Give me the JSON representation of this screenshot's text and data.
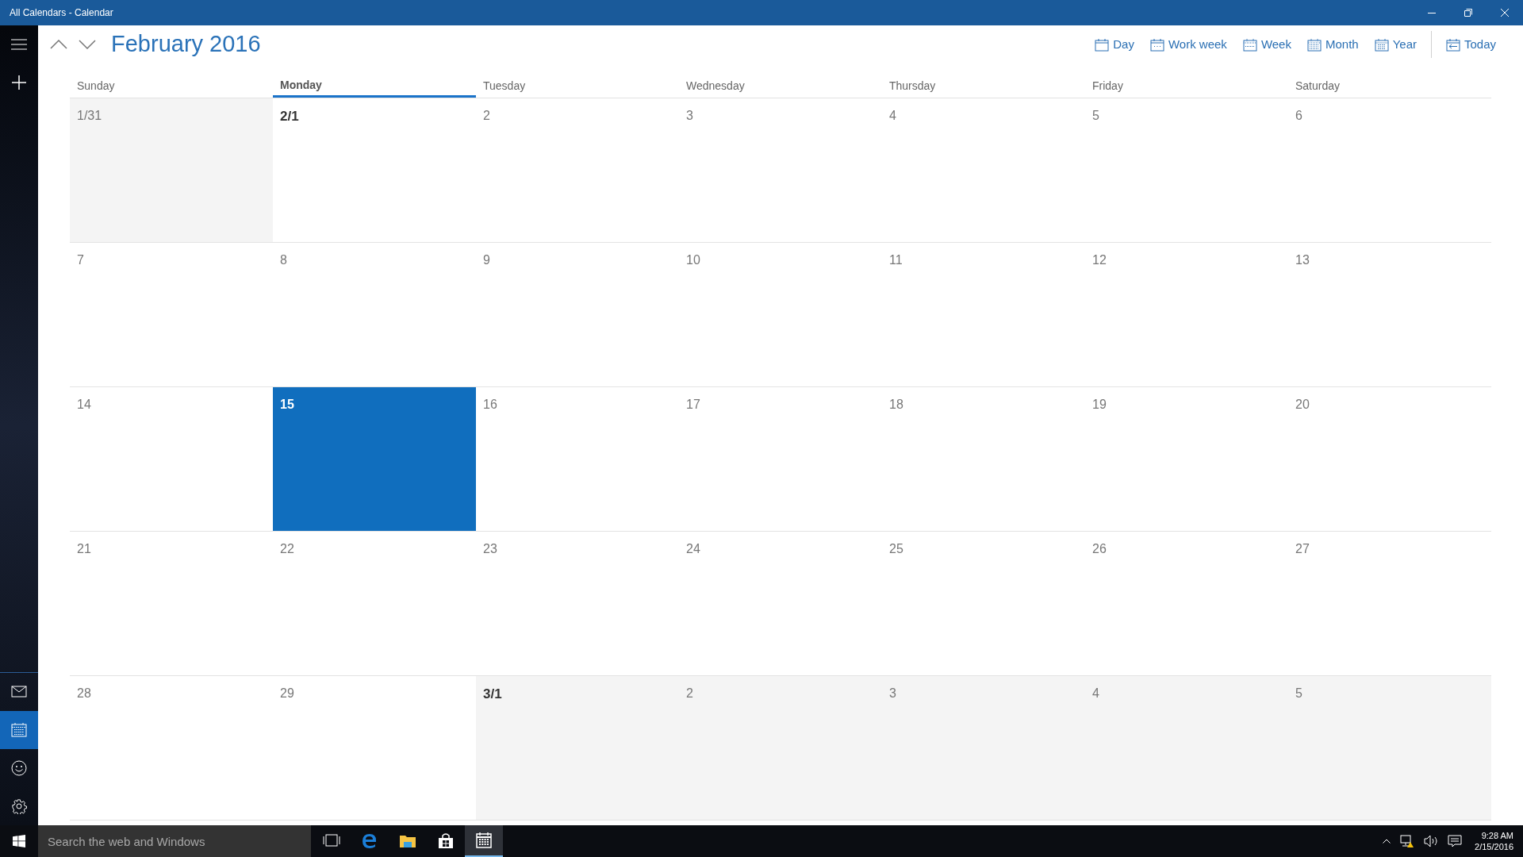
{
  "window": {
    "title": "All Calendars - Calendar"
  },
  "header": {
    "title": "February 2016"
  },
  "views": [
    {
      "label": "Day",
      "kind": "day"
    },
    {
      "label": "Work week",
      "kind": "workweek"
    },
    {
      "label": "Week",
      "kind": "week"
    },
    {
      "label": "Month",
      "kind": "month"
    },
    {
      "label": "Year",
      "kind": "year"
    },
    {
      "label": "Today",
      "kind": "today"
    }
  ],
  "nav": [
    {
      "kind": "mail",
      "selected": false
    },
    {
      "kind": "calendar",
      "selected": true
    },
    {
      "kind": "people",
      "selected": false
    },
    {
      "kind": "settings",
      "selected": false
    }
  ],
  "weekdays": [
    {
      "label": "Sunday",
      "selected": false
    },
    {
      "label": "Monday",
      "selected": true
    },
    {
      "label": "Tuesday",
      "selected": false
    },
    {
      "label": "Wednesday",
      "selected": false
    },
    {
      "label": "Thursday",
      "selected": false
    },
    {
      "label": "Friday",
      "selected": false
    },
    {
      "label": "Saturday",
      "selected": false
    }
  ],
  "weeks": [
    [
      {
        "label": "1/31",
        "kind": "adjacent",
        "month_start": false,
        "selected": false
      },
      {
        "label": "2/1",
        "kind": "current",
        "month_start": true,
        "selected": false
      },
      {
        "label": "2",
        "kind": "current",
        "month_start": false,
        "selected": false
      },
      {
        "label": "3",
        "kind": "current",
        "month_start": false,
        "selected": false
      },
      {
        "label": "4",
        "kind": "current",
        "month_start": false,
        "selected": false
      },
      {
        "label": "5",
        "kind": "current",
        "month_start": false,
        "selected": false
      },
      {
        "label": "6",
        "kind": "current",
        "month_start": false,
        "selected": false
      }
    ],
    [
      {
        "label": "7",
        "kind": "current",
        "month_start": false,
        "selected": false
      },
      {
        "label": "8",
        "kind": "current",
        "month_start": false,
        "selected": false
      },
      {
        "label": "9",
        "kind": "current",
        "month_start": false,
        "selected": false
      },
      {
        "label": "10",
        "kind": "current",
        "month_start": false,
        "selected": false
      },
      {
        "label": "11",
        "kind": "current",
        "month_start": false,
        "selected": false
      },
      {
        "label": "12",
        "kind": "current",
        "month_start": false,
        "selected": false
      },
      {
        "label": "13",
        "kind": "current",
        "month_start": false,
        "selected": false
      }
    ],
    [
      {
        "label": "14",
        "kind": "current",
        "month_start": false,
        "selected": false
      },
      {
        "label": "15",
        "kind": "current",
        "month_start": false,
        "selected": true
      },
      {
        "label": "16",
        "kind": "current",
        "month_start": false,
        "selected": false
      },
      {
        "label": "17",
        "kind": "current",
        "month_start": false,
        "selected": false
      },
      {
        "label": "18",
        "kind": "current",
        "month_start": false,
        "selected": false
      },
      {
        "label": "19",
        "kind": "current",
        "month_start": false,
        "selected": false
      },
      {
        "label": "20",
        "kind": "current",
        "month_start": false,
        "selected": false
      }
    ],
    [
      {
        "label": "21",
        "kind": "current",
        "month_start": false,
        "selected": false
      },
      {
        "label": "22",
        "kind": "current",
        "month_start": false,
        "selected": false
      },
      {
        "label": "23",
        "kind": "current",
        "month_start": false,
        "selected": false
      },
      {
        "label": "24",
        "kind": "current",
        "month_start": false,
        "selected": false
      },
      {
        "label": "25",
        "kind": "current",
        "month_start": false,
        "selected": false
      },
      {
        "label": "26",
        "kind": "current",
        "month_start": false,
        "selected": false
      },
      {
        "label": "27",
        "kind": "current",
        "month_start": false,
        "selected": false
      }
    ],
    [
      {
        "label": "28",
        "kind": "current",
        "month_start": false,
        "selected": false
      },
      {
        "label": "29",
        "kind": "current",
        "month_start": false,
        "selected": false
      },
      {
        "label": "3/1",
        "kind": "adjacent",
        "month_start": true,
        "selected": false
      },
      {
        "label": "2",
        "kind": "adjacent",
        "month_start": false,
        "selected": false
      },
      {
        "label": "3",
        "kind": "adjacent",
        "month_start": false,
        "selected": false
      },
      {
        "label": "4",
        "kind": "adjacent",
        "month_start": false,
        "selected": false
      },
      {
        "label": "5",
        "kind": "adjacent",
        "month_start": false,
        "selected": false
      }
    ]
  ],
  "taskbar": {
    "search": {
      "placeholder": "Search the web and Windows"
    },
    "apps": [
      {
        "kind": "taskview",
        "selected": false
      },
      {
        "kind": "edge",
        "selected": false
      },
      {
        "kind": "explorer",
        "selected": false
      },
      {
        "kind": "store",
        "selected": false
      },
      {
        "kind": "calendar",
        "selected": true
      }
    ],
    "time": "9:28 AM",
    "date": "2/15/2016"
  }
}
